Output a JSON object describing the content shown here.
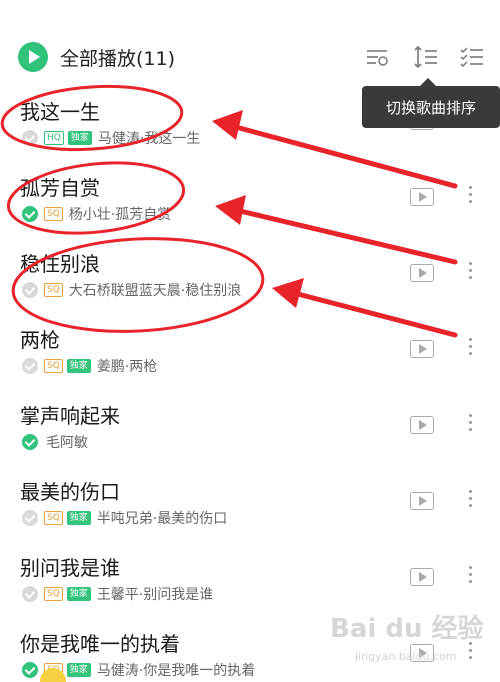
{
  "header": {
    "play_all_label": "全部播放(11)",
    "icons": [
      "download-icon",
      "sort-icon",
      "multi-select-icon"
    ],
    "tooltip": "切换歌曲排序"
  },
  "songs": [
    {
      "title": "我这一生",
      "badges": [
        "HQ",
        "独家"
      ],
      "artist": "马健涛·我这一生",
      "downloaded": false
    },
    {
      "title": "孤芳自赏",
      "badges": [
        "SQ"
      ],
      "artist": "杨小壮·孤芳自赏",
      "downloaded": true
    },
    {
      "title": "稳住别浪",
      "badges": [
        "SQ"
      ],
      "artist": "大石桥联盟蓝天晨·稳住别浪",
      "downloaded": false
    },
    {
      "title": "两枪",
      "badges": [
        "SQ",
        "独家"
      ],
      "artist": "姜鹏·两枪",
      "downloaded": false
    },
    {
      "title": "掌声响起来",
      "badges": [],
      "artist": "毛阿敏",
      "downloaded": true
    },
    {
      "title": "最美的伤口",
      "badges": [
        "SQ",
        "独家"
      ],
      "artist": "半吨兄弟·最美的伤口",
      "downloaded": false
    },
    {
      "title": "别问我是谁",
      "badges": [
        "SQ",
        "独家"
      ],
      "artist": "王馨平·别问我是谁",
      "downloaded": false
    },
    {
      "title": "你是我唯一的执着",
      "badges": [
        "SQ",
        "独家"
      ],
      "artist": "马健涛·你是我唯一的执着",
      "downloaded": true
    }
  ],
  "watermark": {
    "text": "Bai du 经验",
    "sub": "jingyan.baidu.com"
  },
  "colors": {
    "accent": "#31c27c",
    "annotation": "#e8232a",
    "sq_badge": "#e8a23a"
  }
}
